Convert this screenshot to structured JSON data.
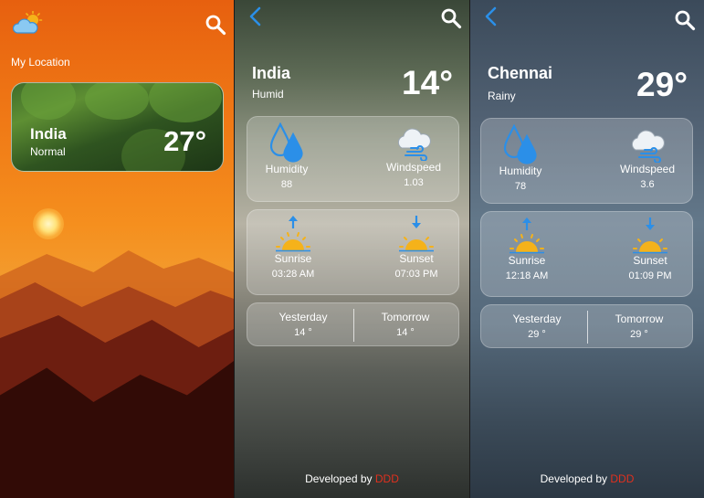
{
  "screen1": {
    "my_location_label": "My Location",
    "card": {
      "country": "India",
      "condition": "Normal",
      "temp": "27°"
    }
  },
  "screen2": {
    "city": "India",
    "condition": "Humid",
    "temp": "14°",
    "humidity": {
      "label": "Humidity",
      "value": "88"
    },
    "windspeed": {
      "label": "Windspeed",
      "value": "1.03"
    },
    "sunrise": {
      "label": "Sunrise",
      "value": "03:28 AM"
    },
    "sunset": {
      "label": "Sunset",
      "value": "07:03 PM"
    },
    "yesterday": {
      "label": "Yesterday",
      "value": "14 °"
    },
    "tomorrow": {
      "label": "Tomorrow",
      "value": "14 °"
    },
    "footer": {
      "prefix": "Developed by",
      "brand": "DDD"
    }
  },
  "screen3": {
    "city": "Chennai",
    "condition": "Rainy",
    "temp": "29°",
    "humidity": {
      "label": "Humidity",
      "value": "78"
    },
    "windspeed": {
      "label": "Windspeed",
      "value": "3.6"
    },
    "sunrise": {
      "label": "Sunrise",
      "value": "12:18 AM"
    },
    "sunset": {
      "label": "Sunset",
      "value": "01:09 PM"
    },
    "yesterday": {
      "label": "Yesterday",
      "value": "29 °"
    },
    "tomorrow": {
      "label": "Tomorrow",
      "value": "29 °"
    },
    "footer": {
      "prefix": "Developed by",
      "brand": "DDD"
    }
  },
  "icons": {
    "logo": "weather-logo-icon",
    "search": "search-icon",
    "back": "back-arrow-icon",
    "humidity": "water-drops-icon",
    "windspeed": "wind-cloud-icon",
    "sunrise": "sunrise-icon",
    "sunset": "sunset-icon"
  },
  "colors": {
    "accent_blue": "#2b8fe8",
    "brand_red": "#e0301e",
    "sun_yellow": "#f5b21a"
  }
}
